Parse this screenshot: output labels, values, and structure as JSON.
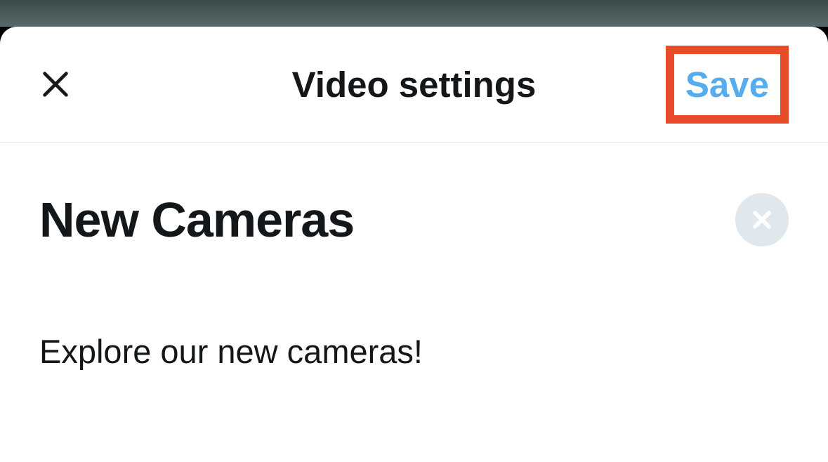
{
  "header": {
    "title": "Video settings",
    "save_label": "Save"
  },
  "form": {
    "title_value": "New Cameras",
    "description_value": "Explore our new cameras!"
  },
  "highlight": {
    "color": "#e84c2b"
  }
}
